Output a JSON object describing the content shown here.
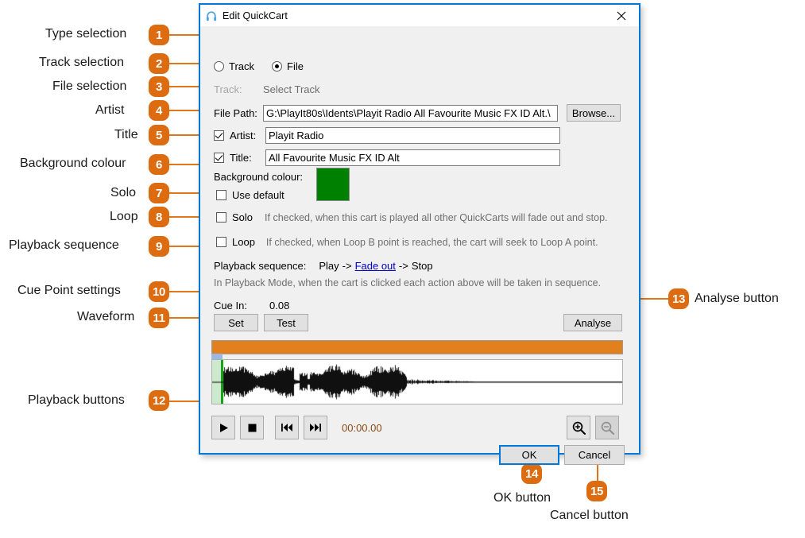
{
  "window": {
    "title": "Edit QuickCart",
    "icon": "headphones-icon",
    "close_label": "×",
    "accent_border": "#0078D7"
  },
  "form": {
    "type_selection": {
      "track_option": "Track",
      "file_option": "File",
      "selected": "File"
    },
    "track_row": {
      "label": "Track:",
      "value": "Select Track",
      "enabled": false
    },
    "file_row": {
      "label": "File Path:",
      "value": "G:\\PlayIt80s\\Idents\\Playit Radio All Favourite Music FX ID Alt.\\",
      "browse_label": "Browse..."
    },
    "artist_row": {
      "label": "Artist:",
      "checked": true,
      "value": "Playit Radio"
    },
    "title_row": {
      "label": "Title:",
      "checked": true,
      "value": "All Favourite Music FX ID Alt"
    },
    "background_colour": {
      "label": "Background colour:",
      "use_default_label": "Use default",
      "use_default_checked": false,
      "swatch_colour": "#008000"
    },
    "solo": {
      "label": "Solo",
      "checked": false,
      "hint": "If checked, when this cart is played all other QuickCarts will fade out and stop."
    },
    "loop": {
      "label": "Loop",
      "checked": false,
      "hint": "If checked, when Loop B point is reached, the cart will seek to Loop A point."
    },
    "playback_sequence": {
      "label": "Playback sequence:",
      "step1": "Play",
      "arrow1": "->",
      "step2_link": "Fade out",
      "arrow2": "->",
      "step3": "Stop",
      "hint": "In Playback Mode, when the cart is clicked each action above will be taken in sequence."
    },
    "cue": {
      "label": "Cue In:",
      "value": "0.08",
      "set_label": "Set",
      "test_label": "Test",
      "analyse_label": "Analyse"
    }
  },
  "transport": {
    "play": "play-icon",
    "stop": "stop-icon",
    "rewind": "rewind-icon",
    "forward": "fast-forward-icon",
    "timecode": "00:00.00",
    "zoom_in": "zoom-in-icon",
    "zoom_out": "zoom-out-icon",
    "zoom_out_disabled": true
  },
  "footer": {
    "ok_label": "OK",
    "cancel_label": "Cancel"
  },
  "annotations": {
    "badge_colour": "#DD6B10",
    "items": [
      {
        "num": "1",
        "label": "Type selection"
      },
      {
        "num": "2",
        "label": "Track selection"
      },
      {
        "num": "3",
        "label": "File selection"
      },
      {
        "num": "4",
        "label": "Artist"
      },
      {
        "num": "5",
        "label": "Title"
      },
      {
        "num": "6",
        "label": "Background colour"
      },
      {
        "num": "7",
        "label": "Solo"
      },
      {
        "num": "8",
        "label": "Loop"
      },
      {
        "num": "9",
        "label": "Playback sequence"
      },
      {
        "num": "10",
        "label": "Cue Point settings"
      },
      {
        "num": "11",
        "label": "Waveform"
      },
      {
        "num": "12",
        "label": "Playback buttons"
      },
      {
        "num": "13",
        "label": "Analyse button"
      },
      {
        "num": "14",
        "label": "OK button"
      },
      {
        "num": "15",
        "label": "Cancel button"
      }
    ]
  }
}
